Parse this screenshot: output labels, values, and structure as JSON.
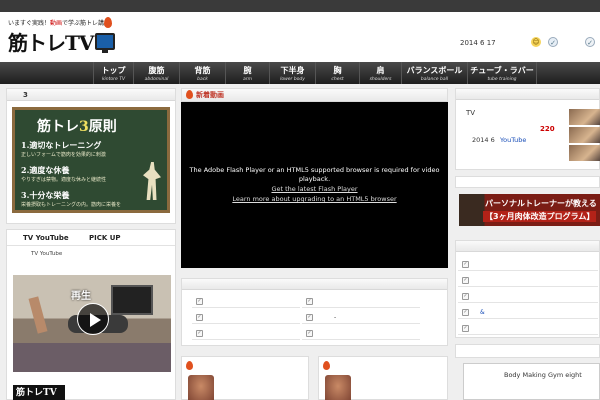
{
  "header": {
    "tagline_pre": "いますぐ実践！",
    "tagline_red": "動画",
    "tagline_post": "で学ぶ筋トレ講座",
    "logo_text": "筋トレTV",
    "date": "2014 6 17"
  },
  "nav": [
    {
      "jp": "トップ",
      "en": "kintore TV"
    },
    {
      "jp": "腹筋",
      "en": "abdominal"
    },
    {
      "jp": "背筋",
      "en": "back"
    },
    {
      "jp": "腕",
      "en": "arm"
    },
    {
      "jp": "下半身",
      "en": "lower body"
    },
    {
      "jp": "胸",
      "en": "chest"
    },
    {
      "jp": "肩",
      "en": "shoulders"
    },
    {
      "jp": "バランスボール",
      "en": "balance ball"
    },
    {
      "jp": "チューブ・ラバー",
      "en": "tube training"
    }
  ],
  "left_panel": {
    "title": "3",
    "chalk": {
      "title_pre": "筋トレ",
      "title_num": "3",
      "title_post": "原則",
      "items": [
        {
          "h": "1.適切なトレーニング",
          "s": "正しいフォームで筋肉を効果的に刺激"
        },
        {
          "h": "2.適度な休養",
          "s": "やりすぎは禁物。適度な休みと継続性"
        },
        {
          "h": "3.十分な栄養",
          "s": "栄養摂取もトレーニングの内。筋肉に栄養を"
        }
      ]
    }
  },
  "tv_tabs": {
    "tab1": "TV YouTube",
    "tab2": "PICK UP",
    "subtitle": "TV YouTube",
    "play_label": "再生",
    "mini_logo": "筋トレTV"
  },
  "new_videos": {
    "title": "新着動画",
    "flash_message": "The Adobe Flash Player or an HTML5 supported browser is required for video playback.",
    "flash_link1": "Get the latest Flash Player",
    "flash_link2": "Learn more about upgrading to an HTML5 browser"
  },
  "center_list": {
    "rows": [
      {
        "left": "",
        "right": ""
      },
      {
        "left": "",
        "right": "-"
      },
      {
        "left": "",
        "right": ""
      }
    ]
  },
  "right_col": {
    "tv_label": "TV",
    "count": "220",
    "date": "2014 6",
    "youtube": "YouTube",
    "banner_line1": "パーソナルトレーナーが教える",
    "banner_line2": "【3ヶ月肉体改造プログラム】",
    "list_rows": [
      "",
      "",
      "",
      "&",
      ""
    ],
    "gym_text": "Body Making Gym eight"
  },
  "colors": {
    "accent_red": "#e0501e",
    "link_blue": "#1a4fb8",
    "chalkboard": "#2f4a32"
  }
}
